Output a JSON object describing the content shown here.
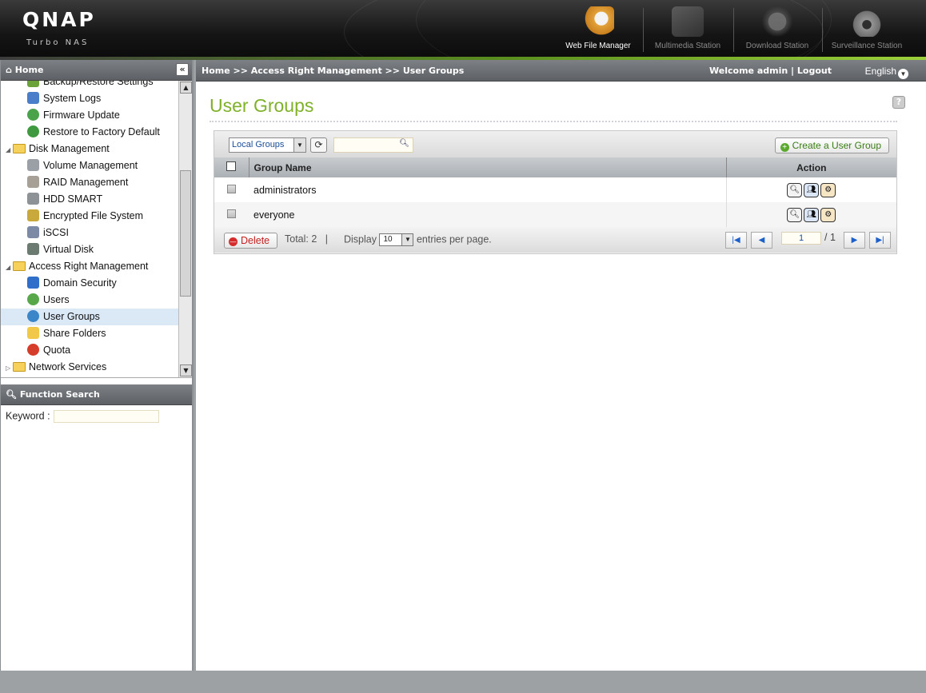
{
  "header": {
    "logo": "QNAP",
    "logo_sub": "Turbo NAS",
    "apps": [
      {
        "label": "Web File Manager",
        "icon": "web-file-manager-icon"
      },
      {
        "label": "Multimedia Station",
        "icon": "multimedia-station-icon"
      },
      {
        "label": "Download Station",
        "icon": "download-station-icon"
      },
      {
        "label": "Surveillance Station",
        "icon": "surveillance-station-icon"
      }
    ]
  },
  "sidebar": {
    "title": "Home",
    "collapse_glyph": "«",
    "items": [
      {
        "label": "Backup/Restore Settings",
        "level": 2
      },
      {
        "label": "System Logs",
        "level": 2
      },
      {
        "label": "Firmware Update",
        "level": 2
      },
      {
        "label": "Restore to Factory Default",
        "level": 2
      },
      {
        "label": "Disk Management",
        "level": 1
      },
      {
        "label": "Volume Management",
        "level": 2
      },
      {
        "label": "RAID Management",
        "level": 2
      },
      {
        "label": "HDD SMART",
        "level": 2
      },
      {
        "label": "Encrypted File System",
        "level": 2
      },
      {
        "label": "iSCSI",
        "level": 2
      },
      {
        "label": "Virtual Disk",
        "level": 2
      },
      {
        "label": "Access Right Management",
        "level": 1
      },
      {
        "label": "Domain Security",
        "level": 2
      },
      {
        "label": "Users",
        "level": 2
      },
      {
        "label": "User Groups",
        "level": 2,
        "selected": true
      },
      {
        "label": "Share Folders",
        "level": 2
      },
      {
        "label": "Quota",
        "level": 2
      },
      {
        "label": "Network Services",
        "level": 1
      }
    ],
    "function_search_title": "Function Search",
    "keyword_label": "Keyword :",
    "keyword_value": ""
  },
  "topbar": {
    "breadcrumb": "Home >> Access Right Management >> User Groups",
    "welcome": "Welcome admin",
    "separator": "|",
    "logout": "Logout",
    "language": "English"
  },
  "main": {
    "title": "User Groups",
    "help_glyph": "?",
    "filter_value": "Local Groups",
    "search_value": "",
    "create_label": "Create a User Group",
    "columns": [
      "Group Name",
      "Action"
    ],
    "rows": [
      {
        "name": "administrators"
      },
      {
        "name": "everyone"
      }
    ],
    "delete_label": "Delete",
    "total_label": "Total:",
    "total_value": "2",
    "divider": "|",
    "display_label": "Display",
    "per_page_value": "10",
    "entries_label": "entries per page.",
    "current_page": "1",
    "page_total": "/ 1"
  },
  "colors": {
    "accent_green": "#7fb12a",
    "header_bar": "#5d6165",
    "selected_row": "#dbe8f6"
  }
}
